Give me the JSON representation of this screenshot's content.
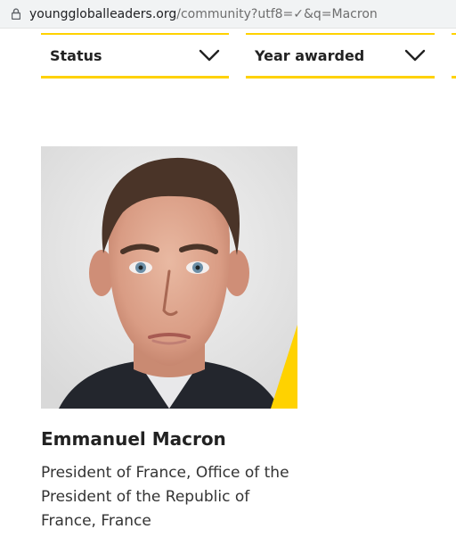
{
  "browser": {
    "url_domain": "younggloballeaders.org",
    "url_path": "/community?utf8=✓&q=Macron"
  },
  "filters": [
    {
      "label": "Status"
    },
    {
      "label": "Year awarded"
    }
  ],
  "colors": {
    "accent": "#ffd200",
    "text": "#222222"
  },
  "result": {
    "name": "Emmanuel Macron",
    "role": "President of France, Office of the President of the Republic of France, France"
  }
}
